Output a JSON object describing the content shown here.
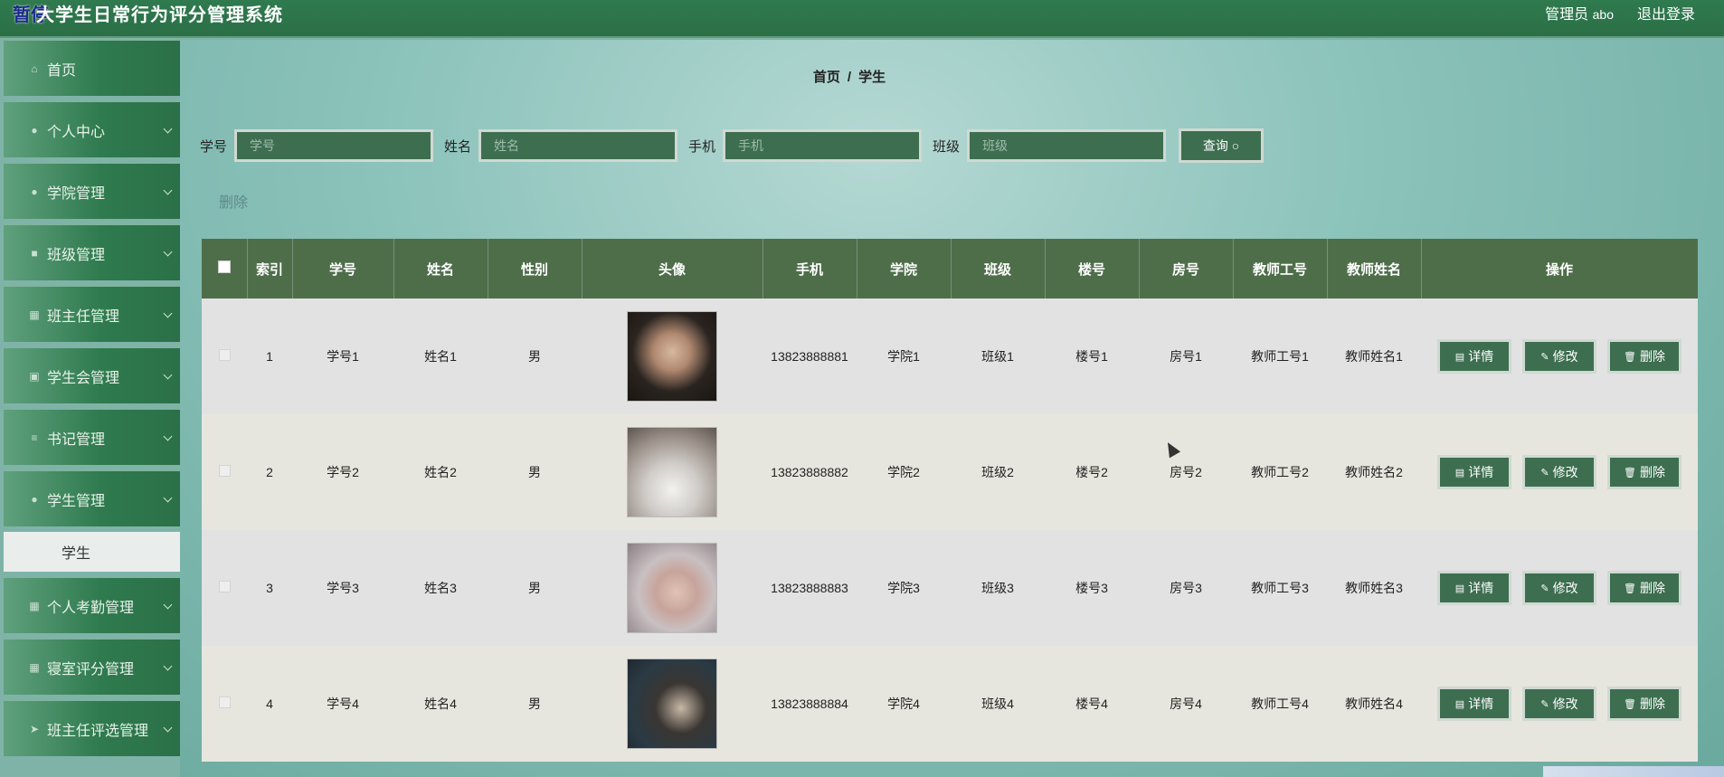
{
  "header": {
    "logo_char": "暂停",
    "title": "大学生日常行为评分管理系统",
    "admin_label": "管理员",
    "username": "abo",
    "logout": "退出登录"
  },
  "sidebar": {
    "items": [
      {
        "label": "首页",
        "icon": "home-icon",
        "glyph": "⌂",
        "chevron": false
      },
      {
        "label": "个人中心",
        "icon": "user-icon",
        "glyph": "●",
        "chevron": true
      },
      {
        "label": "学院管理",
        "icon": "user-icon",
        "glyph": "●",
        "chevron": true
      },
      {
        "label": "班级管理",
        "icon": "chat-icon",
        "glyph": "■",
        "chevron": true
      },
      {
        "label": "班主任管理",
        "icon": "grid-icon",
        "glyph": "▦",
        "chevron": true
      },
      {
        "label": "学生会管理",
        "icon": "checkbox-icon",
        "glyph": "▣",
        "chevron": true
      },
      {
        "label": "书记管理",
        "icon": "list-icon",
        "glyph": "≡",
        "chevron": true
      },
      {
        "label": "学生管理",
        "icon": "user-icon",
        "glyph": "●",
        "chevron": true
      }
    ],
    "sub_item": "学生",
    "items_after": [
      {
        "label": "个人考勤管理",
        "icon": "grid-icon",
        "glyph": "▦",
        "chevron": true
      },
      {
        "label": "寝室评分管理",
        "icon": "grid-icon",
        "glyph": "▦",
        "chevron": true
      },
      {
        "label": "班主任评选管理",
        "icon": "send-icon",
        "glyph": "➤",
        "chevron": true
      }
    ]
  },
  "breadcrumb": {
    "home": "首页",
    "sep": "/",
    "current": "学生"
  },
  "search": {
    "fields": [
      {
        "label": "学号",
        "placeholder": "学号"
      },
      {
        "label": "姓名",
        "placeholder": "姓名"
      },
      {
        "label": "手机",
        "placeholder": "手机"
      },
      {
        "label": "班级",
        "placeholder": "班级"
      }
    ],
    "query_label": "查询",
    "query_icon": "search-icon"
  },
  "delete_label": "删除",
  "table": {
    "headers": [
      "",
      "索引",
      "学号",
      "姓名",
      "性别",
      "头像",
      "手机",
      "学院",
      "班级",
      "楼号",
      "房号",
      "教师工号",
      "教师姓名",
      "操作"
    ],
    "rows": [
      {
        "index": "1",
        "sid": "学号1",
        "name": "姓名1",
        "gender": "男",
        "avatar": "av1",
        "phone": "13823888881",
        "college": "学院1",
        "class": "班级1",
        "building": "楼号1",
        "room": "房号1",
        "tid": "教师工号1",
        "tname": "教师姓名1"
      },
      {
        "index": "2",
        "sid": "学号2",
        "name": "姓名2",
        "gender": "男",
        "avatar": "av2",
        "phone": "13823888882",
        "college": "学院2",
        "class": "班级2",
        "building": "楼号2",
        "room": "房号2",
        "tid": "教师工号2",
        "tname": "教师姓名2"
      },
      {
        "index": "3",
        "sid": "学号3",
        "name": "姓名3",
        "gender": "男",
        "avatar": "av3",
        "phone": "13823888883",
        "college": "学院3",
        "class": "班级3",
        "building": "楼号3",
        "room": "房号3",
        "tid": "教师工号3",
        "tname": "教师姓名3"
      },
      {
        "index": "4",
        "sid": "学号4",
        "name": "姓名4",
        "gender": "男",
        "avatar": "av4",
        "phone": "13823888884",
        "college": "学院4",
        "class": "班级4",
        "building": "楼号4",
        "room": "房号4",
        "tid": "教师工号4",
        "tname": "教师姓名4"
      }
    ],
    "ops": {
      "detail": "详情",
      "edit": "修改",
      "delete": "删除"
    }
  },
  "colors": {
    "primary": "#2f7a4e",
    "button": "#3d6e50",
    "header_row": "#4e6e4a"
  }
}
